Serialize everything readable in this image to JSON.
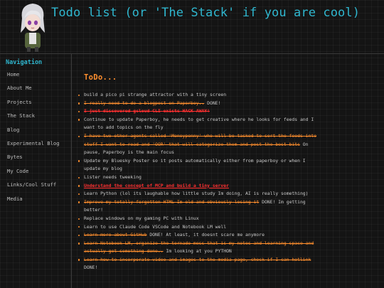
{
  "header": {
    "title": "Todo list (or 'The Stack' if you are cool)"
  },
  "nav": {
    "heading": "Navigation",
    "items": [
      "Home",
      "About Me",
      "Projects",
      "The Stack",
      "Blog",
      "Experimental Blog",
      "Bytes",
      "My Code",
      "Links/Cool Stuff",
      "Media"
    ]
  },
  "main": {
    "title": "ToDo...",
    "items": [
      [
        {
          "t": "build a pico pi strange attractor with a tiny screen"
        }
      ],
      [
        {
          "t": "I really need to do a blogpost on Paperboy..",
          "s": "s"
        },
        {
          "t": " DONE!"
        }
      ],
      [
        {
          "t": "I just discovered gcloud CLI exists HACK AWAY!",
          "s": "r"
        }
      ],
      [
        {
          "t": "Continue to update Paperboy, he needs to get creative where he looks for feeds and I want to add topics on the fly"
        }
      ],
      [
        {
          "t": "I have two other agents called 'Moneypenny' who will be tasked to sort the feeds into stuff I want to read and 'OOR' that will categorize them and post the best bits",
          "s": "s"
        },
        {
          "t": " On pause, Paperboy is the main focus"
        }
      ],
      [
        {
          "t": "Update my Bluesky Poster so it posts automatically either from paperboy or when I update my blog"
        }
      ],
      [
        {
          "t": "Lister needs tweeking"
        }
      ],
      [
        {
          "t": "Understand the concept of MCP and build a tiny server",
          "s": "u"
        }
      ],
      [
        {
          "t": "Learn Python (lol its laughable how little study Im doing, AI is really something)"
        }
      ],
      [
        {
          "t": "Improve my totally forgotten HTML Im old and obviously losing it",
          "s": "s"
        },
        {
          "t": " DONE! Im getting better!"
        }
      ],
      [
        {
          "t": "Replace windows on my gaming PC with Linux"
        }
      ],
      [
        {
          "t": "Learn to use Claude Code VSCode and Notebook LM well"
        }
      ],
      [
        {
          "t": "Learn more about GitHub",
          "s": "s"
        },
        {
          "t": " DONE! At least, it doesnt scare me anymore"
        }
      ],
      [
        {
          "t": "Learn Notebook LM, organize the tornado mess that is my notes and learning space and actually get something done..",
          "s": "s"
        },
        {
          "t": " Im looking at you PYTHON"
        }
      ],
      [
        {
          "t": "Learn how to incorporate video and images to the media page, check if I can hotlink",
          "s": "s"
        },
        {
          "t": " DONE!"
        }
      ]
    ]
  },
  "colors": {
    "accent": "#2fb7cf",
    "orange": "#ff8f2e",
    "red": "#ff3030",
    "background": "#141414"
  },
  "icons": {
    "avatar": "anime-girl-avatar"
  }
}
